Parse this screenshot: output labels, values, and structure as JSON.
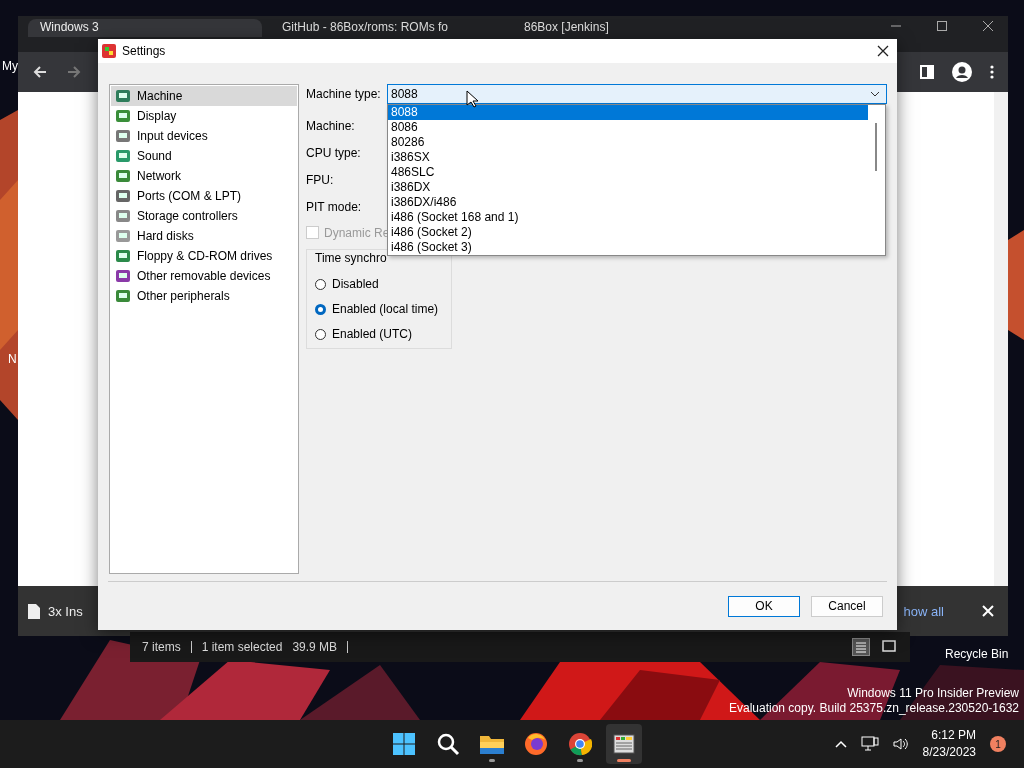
{
  "desktop": {
    "icon_labels": [
      "My",
      "N"
    ],
    "recycle_bin": "Recycle Bin",
    "watermark": [
      "Windows 11 Pro Insider Preview",
      "Evaluation copy. Build 25375.zn_release.230520-1632"
    ]
  },
  "browser": {
    "tabs": [
      {
        "title": "Windows 3",
        "selected": true
      },
      {
        "title": "GitHub - 86Box/roms: ROMs fo",
        "selected": false
      },
      {
        "title": "86Box [Jenkins]",
        "selected": false
      }
    ],
    "download": {
      "file": "3x Ins",
      "show_all": "how all"
    }
  },
  "explorer_status": {
    "items": "7 items",
    "selected": "1 item selected",
    "size": "39.9 MB"
  },
  "dialog": {
    "title": "Settings",
    "categories": [
      {
        "label": "Machine",
        "selected": true
      },
      {
        "label": "Display",
        "selected": false
      },
      {
        "label": "Input devices",
        "selected": false
      },
      {
        "label": "Sound",
        "selected": false
      },
      {
        "label": "Network",
        "selected": false
      },
      {
        "label": "Ports (COM & LPT)",
        "selected": false
      },
      {
        "label": "Storage controllers",
        "selected": false
      },
      {
        "label": "Hard disks",
        "selected": false
      },
      {
        "label": "Floppy & CD-ROM drives",
        "selected": false
      },
      {
        "label": "Other removable devices",
        "selected": false
      },
      {
        "label": "Other peripherals",
        "selected": false
      }
    ],
    "machine_type": {
      "label": "Machine type:",
      "value": "8088",
      "options": [
        {
          "label": "8088",
          "selected": true
        },
        {
          "label": "8086",
          "selected": false
        },
        {
          "label": "80286",
          "selected": false
        },
        {
          "label": "i386SX",
          "selected": false
        },
        {
          "label": "486SLC",
          "selected": false
        },
        {
          "label": "i386DX",
          "selected": false
        },
        {
          "label": "i386DX/i486",
          "selected": false
        },
        {
          "label": "i486 (Socket 168 and 1)",
          "selected": false
        },
        {
          "label": "i486 (Socket 2)",
          "selected": false
        },
        {
          "label": "i486 (Socket 3)",
          "selected": false
        }
      ]
    },
    "field_labels": [
      "Machine:",
      "CPU type:",
      "FPU:",
      "PIT mode:"
    ],
    "dynamic_recompiler": {
      "label": "Dynamic Re",
      "checked": false,
      "disabled": true
    },
    "time_sync": {
      "title": "Time synchro",
      "options": [
        {
          "label": "Disabled",
          "selected": false
        },
        {
          "label": "Enabled (local time)",
          "selected": true
        },
        {
          "label": "Enabled (UTC)",
          "selected": false
        }
      ]
    },
    "buttons": [
      {
        "label": "OK",
        "default": true
      },
      {
        "label": "Cancel",
        "default": false
      }
    ]
  },
  "taskbar": {
    "apps": [
      {
        "kind": "start",
        "running": false
      },
      {
        "kind": "search",
        "running": false
      },
      {
        "kind": "folder",
        "running": true
      },
      {
        "kind": "firefox",
        "running": false
      },
      {
        "kind": "chrome",
        "running": true
      },
      {
        "kind": "emulator",
        "running": true
      }
    ],
    "time": "6:12 PM",
    "date": "8/23/2023",
    "notifications": "1"
  }
}
